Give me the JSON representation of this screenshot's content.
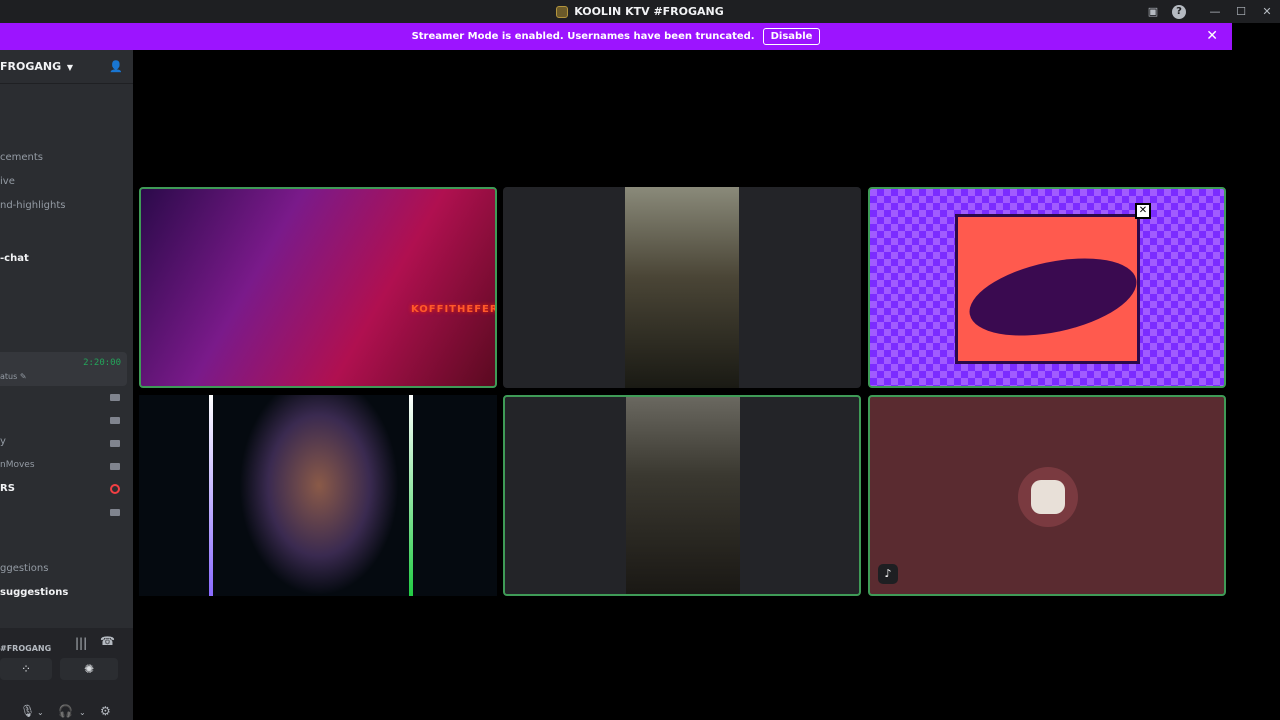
{
  "window": {
    "title": "KOOLIN KTV #FROGANG"
  },
  "banner": {
    "message": "Streamer Mode is enabled. Usernames have been truncated.",
    "disable_label": "Disable"
  },
  "server": {
    "name": "FROGANG"
  },
  "channels": [
    "cements",
    "ive",
    "nd-highlights",
    "-chat"
  ],
  "voice": {
    "timer": "2:20:00",
    "status_text": "atus"
  },
  "voice_members": [
    "y",
    "nMoves",
    "RS"
  ],
  "bottom_channels": [
    "ggestions",
    "suggestions"
  ],
  "voice_panel": {
    "channel_name": "#FROGANG"
  },
  "video": {
    "tile1_sign": "KOFFITHEFERKY"
  },
  "colors": {
    "banner": "#9c14ff",
    "speaking_border": "#3f9b57",
    "timer": "#23a55a"
  }
}
